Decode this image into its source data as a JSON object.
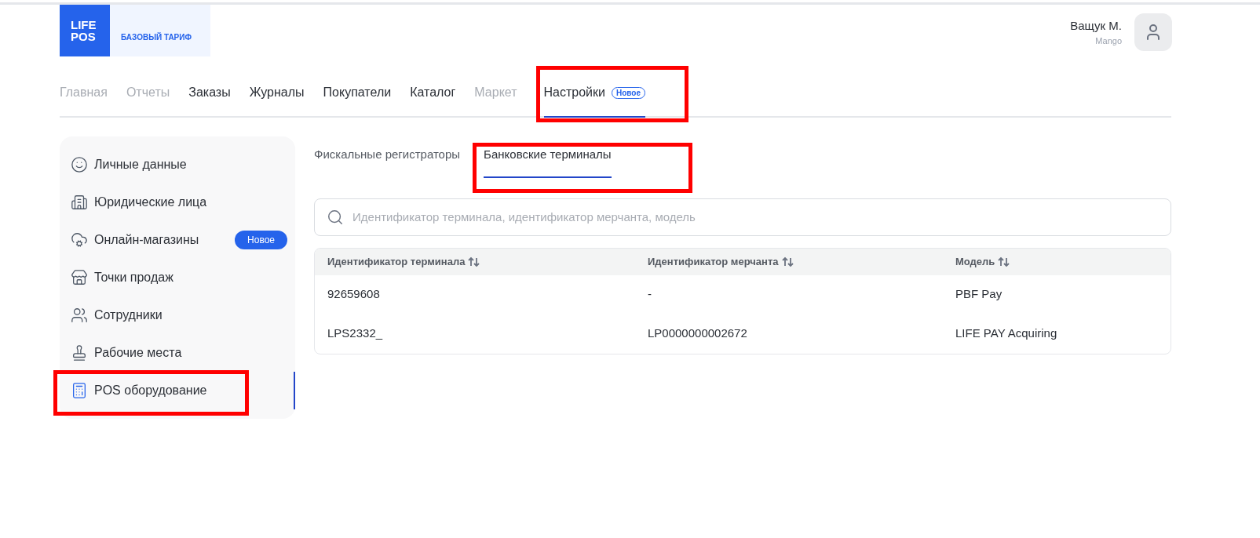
{
  "header": {
    "logo": [
      "LIFE",
      "POS"
    ],
    "plan": "БАЗОВЫЙ ТАРИФ",
    "user": {
      "name": "Ващук М.",
      "company": "Mango"
    }
  },
  "nav": [
    {
      "label": "Главная",
      "disabled": true,
      "selected": false
    },
    {
      "label": "Отчеты",
      "disabled": true,
      "selected": false
    },
    {
      "label": "Заказы",
      "disabled": false,
      "selected": false
    },
    {
      "label": "Журналы",
      "disabled": false,
      "selected": false
    },
    {
      "label": "Покупатели",
      "disabled": false,
      "selected": false
    },
    {
      "label": "Каталог",
      "disabled": false,
      "selected": false
    },
    {
      "label": "Маркет",
      "disabled": true,
      "selected": false
    },
    {
      "label": "Настройки",
      "badge": "Новое",
      "disabled": false,
      "selected": true
    }
  ],
  "sidebar": {
    "items": [
      {
        "label": "Личные данные",
        "selected": false
      },
      {
        "label": "Юридические лица",
        "selected": false
      },
      {
        "label": "Онлайн-магазины",
        "badge": "Новое",
        "selected": false
      },
      {
        "label": "Точки продаж",
        "selected": false
      },
      {
        "label": "Сотрудники",
        "selected": false
      },
      {
        "label": "Рабочие места",
        "selected": false
      },
      {
        "label": "POS оборудование",
        "selected": true
      }
    ]
  },
  "tabs": [
    {
      "label": "Фискальные регистраторы",
      "selected": false
    },
    {
      "label": "Банковские терминалы",
      "selected": true
    }
  ],
  "search": {
    "placeholder": "Идентификатор терминала, идентификатор мерчанта, модель"
  },
  "table": {
    "columns": [
      "Идентификатор терминала",
      "Идентификатор мерчанта",
      "Модель"
    ],
    "rows": [
      [
        "92659608",
        "-",
        "PBF Pay"
      ],
      [
        "LPS2332_",
        "LP0000000002672",
        "LIFE PAY Acquiring"
      ]
    ]
  }
}
